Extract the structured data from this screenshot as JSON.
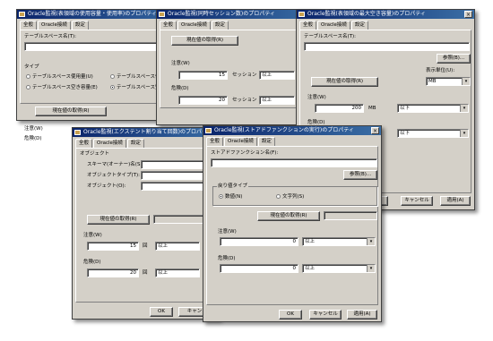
{
  "common": {
    "close_glyph": "×",
    "dropdown_glyph": "▾",
    "spin_glyph": "▲▼"
  },
  "win1": {
    "title": "Oracle監視(表領域の使用容量・使用率)のプロパティ",
    "tabs": [
      "全般",
      "Oracle接続",
      "設定"
    ],
    "tablespace_label": "テーブルスペース名(T):",
    "type_label": "タイプ",
    "type_options": [
      "テーブルスペース使用量(U)",
      "テーブルスペース使",
      "テーブルスペース空き容量(E)",
      "テーブルスペース空"
    ],
    "current_btn": "現在値の取得(R)",
    "warn_label": "注意(W)",
    "crit_label": "危険(D)"
  },
  "win2": {
    "title": "Oracle監視(同時セッション数)のプロパティ",
    "tabs": [
      "全般",
      "Oracle接続",
      "設定"
    ],
    "current_btn": "現在値の取得(R)",
    "warn_label": "注意(W)",
    "warn_value": "15",
    "warn_unit": "セッション",
    "warn_cond": "以上",
    "crit_label": "危険(D)",
    "crit_value": "20",
    "crit_unit": "セッション",
    "crit_cond": "以上"
  },
  "win3": {
    "title": "Oracle監視(表領域の最大空き容量)のプロパティ",
    "tabs": [
      "全般",
      "Oracle接続",
      "設定"
    ],
    "tablespace_label": "テーブルスペース名(T):",
    "browse_btn": "参照(B)...",
    "unit_label": "表示単位(U):",
    "unit_value": "MB",
    "current_btn": "現在値の取得(R)",
    "warn_label": "注意(W)",
    "warn_value": "200",
    "warn_unit": "MB",
    "warn_cond": "以下",
    "crit_label": "危険(D)",
    "crit_cond": "以下",
    "ok_btn": "OK",
    "cancel_btn": "キャンセル",
    "apply_btn": "適用(A)"
  },
  "win4": {
    "title": "Oracle監視(エクステント割り当て回数)のプロパティ",
    "tabs": [
      "全般",
      "Oracle接続",
      "設定"
    ],
    "object_group": "オブジェクト",
    "schema_label": "スキーマ(オーナー)名(S):",
    "objtype_label": "オブジェクトタイプ(T):",
    "objname_label": "オブジェクト(O):",
    "current_btn": "現在値の取得(R)",
    "warn_label": "注意(W)",
    "warn_value": "15",
    "warn_unit": "回",
    "warn_cond": "以上",
    "crit_label": "危険(D)",
    "crit_value": "20",
    "crit_unit": "回",
    "crit_cond": "以上",
    "ok_btn": "OK",
    "cancel_btn": "キャン"
  },
  "win5": {
    "title": "Oracle監視(ストアドファンクションの実行)のプロパティ",
    "tabs": [
      "全般",
      "Oracle接続",
      "設定"
    ],
    "func_label": "ストアドファンクション名(F):",
    "browse_btn": "参照(B)...",
    "type_group": "戻り値タイプ",
    "type_options": [
      "数値(N)",
      "文字列(S)"
    ],
    "current_btn": "現在値の取得(R)",
    "warn_label": "注意(W)",
    "warn_value": "0",
    "warn_cond": "以上",
    "crit_label": "危険(D)",
    "crit_value": "0",
    "crit_cond": "以上",
    "ok_btn": "OK",
    "cancel_btn": "キャンセル",
    "apply_btn": "適用(A)"
  }
}
